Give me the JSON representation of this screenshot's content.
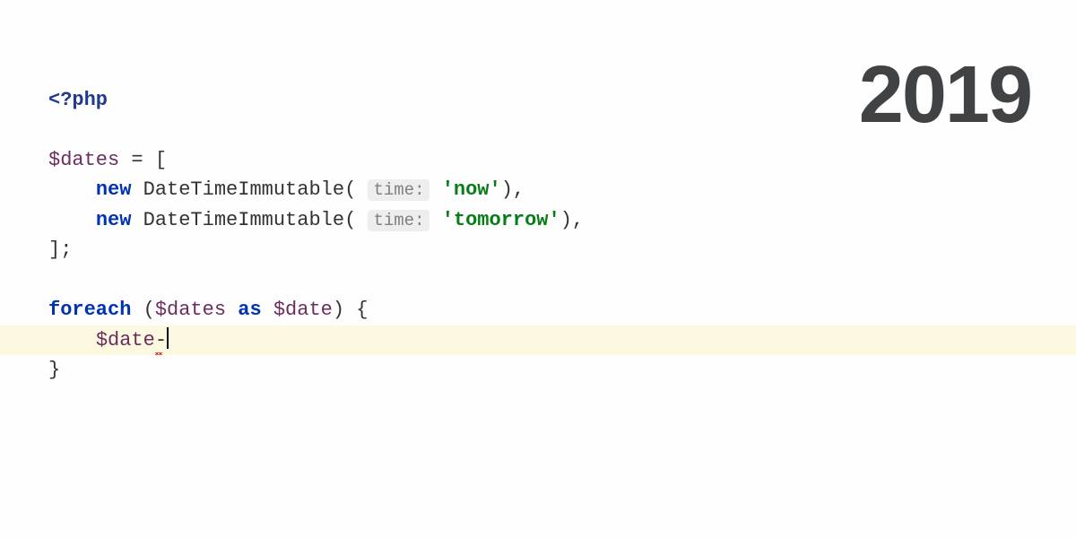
{
  "year": "2019",
  "code": {
    "phpOpen": "<?php",
    "varDates": "$dates",
    "equals": " = ",
    "openBracket": "[",
    "indent": "    ",
    "newKw": "new",
    "className": "DateTimeImmutable",
    "openParen": "(",
    "paramHint": "time:",
    "string1": "'now'",
    "string2": "'tomorrow'",
    "closeParen": ")",
    "comma": ",",
    "closeBracket": "]",
    "semi": ";",
    "foreachKw": "foreach",
    "asKw": "as",
    "varDate": "$date",
    "openBrace": "{",
    "closeBrace": "}",
    "arrow": "-",
    "space": " "
  }
}
